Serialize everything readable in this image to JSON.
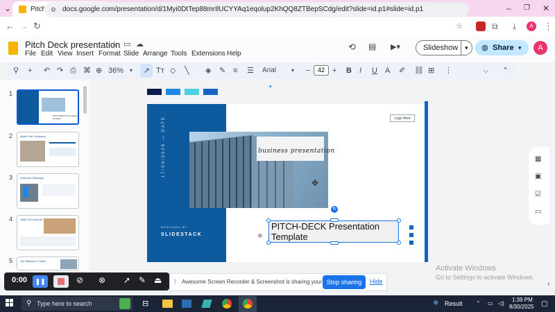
{
  "browser": {
    "tab_title": "Pitch Deck presentation - Goog",
    "url": "docs.google.com/presentation/d/1Myi0DtTep88mrIlUCYYAq1eqolup2KhQQ8ZTBepSCdg/edit?slide=id.p1#slide=id.p1",
    "avatar_letter": "A"
  },
  "docs": {
    "title": "Pitch Deck presentation",
    "menu": [
      "File",
      "Edit",
      "View",
      "Insert",
      "Format",
      "Slide",
      "Arrange",
      "Tools",
      "Extensions",
      "Help"
    ],
    "slideshow_label": "Slideshow",
    "share_label": "Share",
    "avatar_letter": "A"
  },
  "toolbar": {
    "zoom": "36%",
    "font": "Arial",
    "font_size": "42"
  },
  "filmstrip": {
    "numbers": [
      "1",
      "2",
      "3",
      "4",
      "5"
    ],
    "thumb_titles": [
      "PITCH-DECK Presentation Template",
      "About Our Company",
      "Welcome Message",
      "Table Of Contents",
      "Our Mission & Vision"
    ]
  },
  "slide": {
    "date_vertical": "17/04/2026 — DATE",
    "logo_box": "Logo Here",
    "overlay_text": "business presentation",
    "designed_by": "DESIGNED BY",
    "brand": "SLIDESTACK",
    "title_line1": "PITCH-DECK Presentation",
    "title_line2": "Template"
  },
  "recorder": {
    "time": "0:00",
    "sharing_message": "Awesome Screen Recorder & Screenshot is sharing your screen.",
    "stop_label": "Stop sharing",
    "hide_label": "Hide"
  },
  "watermark": {
    "line1": "Activate Windows",
    "line2": "Go to Settings to activate Windows."
  },
  "taskbar": {
    "search_placeholder": "Type here to search",
    "weather": "Result",
    "time": "1:39 PM",
    "date": "8/30/2025"
  },
  "colors": {
    "accent_blue": "#0e5a9e",
    "swatch_navy": "#0a1a4a",
    "swatch_blue": "#1e88e5",
    "swatch_cyan": "#4dd0e1",
    "swatch_steel": "#1565c0"
  }
}
